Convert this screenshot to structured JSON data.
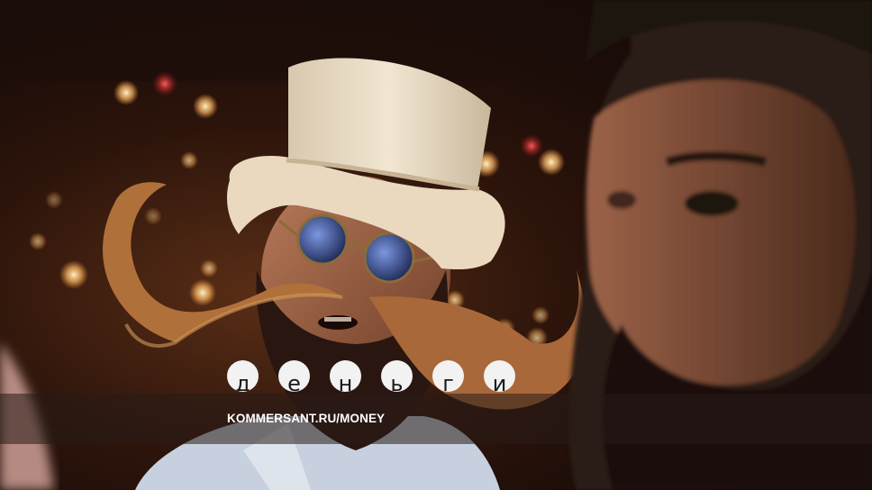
{
  "brand": {
    "letters": [
      "д",
      "е",
      "н",
      "ь",
      "г",
      "и"
    ],
    "site_url": "KOMMERSANT.RU/MONEY"
  },
  "scene": {
    "subject": "man with long curled moustache, top hat and blue round glasses",
    "background_tone": "#1a0d08",
    "hat_color": "#efe2cc",
    "lens_color": "#3f5aa8",
    "beard_color": "#b0703a"
  }
}
